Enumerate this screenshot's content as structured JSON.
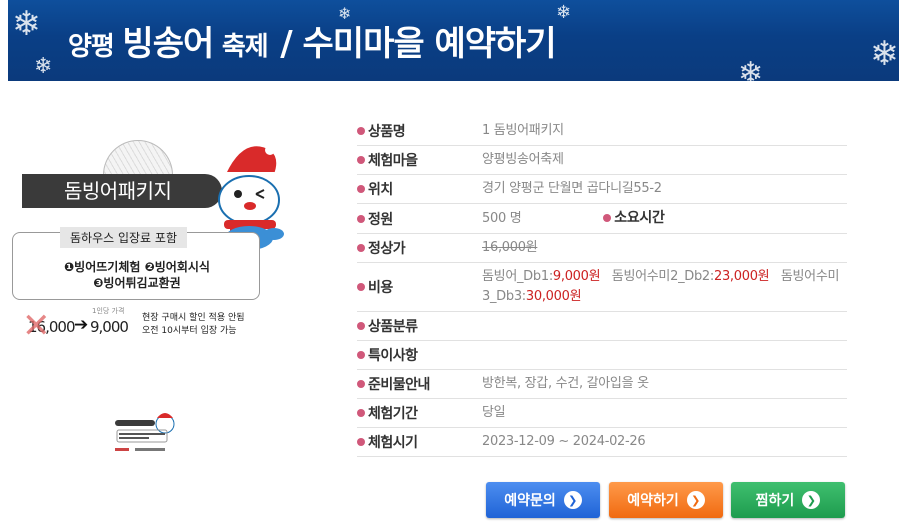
{
  "banner": {
    "title_part1": "양평",
    "title_part2": "빙송어",
    "title_part3": "축제",
    "title_part4": "/ 수미마을 예약하기"
  },
  "promo": {
    "package_name": "돔빙어패키지",
    "includes_label": "돔하우스 입장료 포함",
    "includes_line1": "❶빙어뜨기체험 ❷빙어회시식",
    "includes_line2": "❸빙어튀김교환권",
    "price_caption": "1인당 가격",
    "price_old": "16,000",
    "price_new": "9,000",
    "note_line1": "현장 구매시 할인 적용 안됨",
    "note_line2": "오전 10시부터 입장 가능"
  },
  "info": {
    "product_name": {
      "label": "상품명",
      "value": "1 돔빙어패키지"
    },
    "village": {
      "label": "체험마을",
      "value": "양평빙송어축제"
    },
    "location": {
      "label": "위치",
      "value": "경기 양평군 단월면 곱다니길55-2"
    },
    "capacity": {
      "label": "정원",
      "value": "500 명",
      "duration_label": "소요시간"
    },
    "regular_price": {
      "label": "정상가",
      "value": "16,000원"
    },
    "cost": {
      "label": "비용",
      "item1_name": "돔빙어_Db1:",
      "item1_price": "9,000원",
      "item2_name": "돔빙어수미2_Db2:",
      "item2_price": "23,000원",
      "item3_name": "돔빙어수미3_Db3:",
      "item3_price": "30,000원"
    },
    "category": {
      "label": "상품분류",
      "value": ""
    },
    "notes": {
      "label": "특이사항",
      "value": ""
    },
    "prep": {
      "label": "준비물안내",
      "value": "방한복, 장갑, 수건, 갈아입을 옷"
    },
    "period": {
      "label": "체험기간",
      "value": "당일"
    },
    "time": {
      "label": "체험시기",
      "value": "2023-12-09 ~ 2024-02-26"
    }
  },
  "buttons": {
    "inquiry": "예약문의",
    "reserve": "예약하기",
    "wish": "찜하기"
  },
  "colors": {
    "banner": "#0b3f86",
    "bullet": "#d0587a",
    "price_red": "#cc2222",
    "btn_blue": "#1f63d6",
    "btn_orange": "#f06a10",
    "btn_green": "#1e9c4e"
  }
}
